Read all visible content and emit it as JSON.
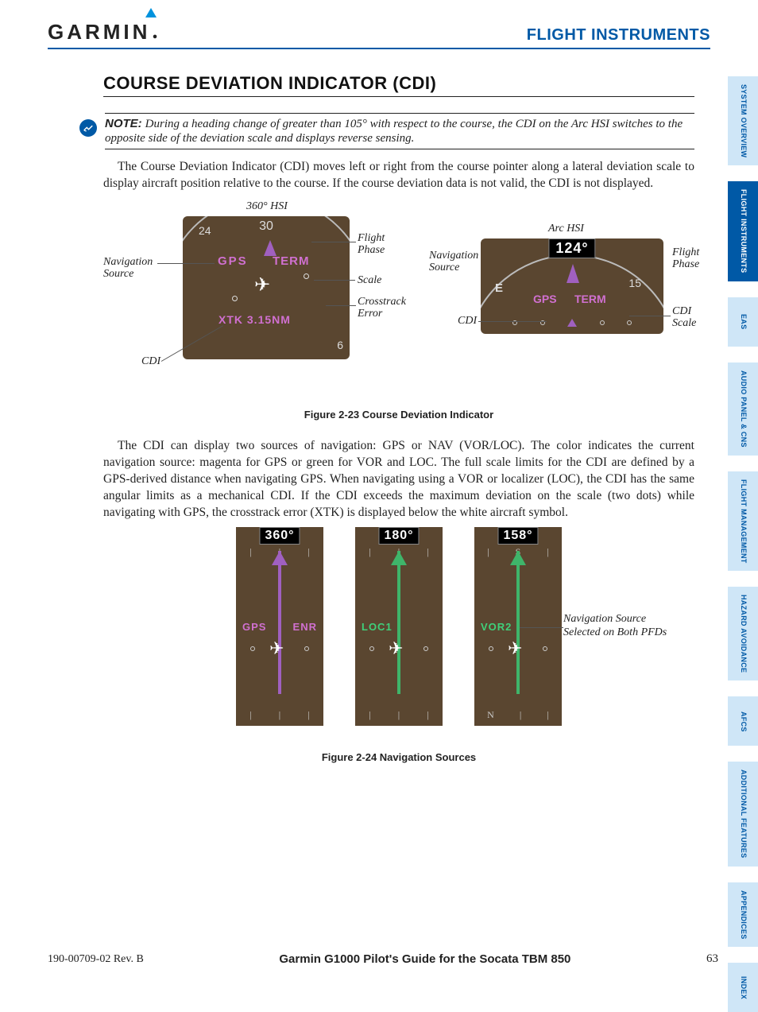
{
  "header": {
    "brand": "GARMIN",
    "section": "FLIGHT INSTRUMENTS"
  },
  "heading": "COURSE DEVIATION INDICATOR (CDI)",
  "note": {
    "label": "NOTE:",
    "text": "During a heading change of greater than 105° with respect to the course, the CDI on the Arc HSI switches to the opposite side of the deviation scale and displays reverse sensing."
  },
  "paragraphs": {
    "p1": "The Course Deviation Indicator (CDI) moves left or right from the course pointer along a lateral deviation scale to display aircraft position relative to the course.  If the course deviation data is not valid, the CDI is not displayed.",
    "p2": "The CDI can display two sources of navigation: GPS or NAV (VOR/LOC).  The color indicates the current navigation source: magenta for GPS or green for VOR and LOC.  The full scale limits for the CDI are defined by a GPS-derived distance when navigating GPS.  When navigating using a VOR or localizer (LOC), the CDI has the same angular limits as a mechanical CDI.  If the CDI exceeds the maximum deviation on the scale (two dots) while navigating with GPS, the crosstrack error (XTK) is displayed below the white aircraft symbol."
  },
  "fig23": {
    "caption": "Figure 2-23  Course Deviation Indicator",
    "left_title": "360° HSI",
    "right_title": "Arc HSI",
    "hsi360": {
      "gps": "GPS",
      "term": "TERM",
      "xtk": "XTK 3.15NM",
      "tick_top": "30",
      "tick_left": "24",
      "tick_right": "6"
    },
    "arc": {
      "heading": "124°",
      "gps": "GPS",
      "term": "TERM",
      "tick_e": "E",
      "tick_15": "15"
    },
    "callouts": {
      "nav_src": "Navigation\nSource",
      "flight_phase": "Flight\nPhase",
      "scale": "Scale",
      "xtk_err": "Crosstrack\nError",
      "cdi": "CDI",
      "cdi_scale": "CDI\nScale"
    }
  },
  "fig24": {
    "caption": "Figure 2-24  Navigation Sources",
    "strips": [
      {
        "heading": "360°",
        "src_left": "GPS",
        "src_right": "ENR"
      },
      {
        "heading": "180°",
        "src_left": "LOC1",
        "src_right": ""
      },
      {
        "heading": "158°",
        "src_left": "VOR2",
        "src_right": ""
      }
    ],
    "callout": "Navigation Source Selected on Both PFDs"
  },
  "tabs": [
    {
      "label": "SYSTEM OVERVIEW",
      "active": false
    },
    {
      "label": "FLIGHT INSTRUMENTS",
      "active": true
    },
    {
      "label": "EAS",
      "active": false
    },
    {
      "label": "AUDIO PANEL & CNS",
      "active": false
    },
    {
      "label": "FLIGHT MANAGEMENT",
      "active": false
    },
    {
      "label": "HAZARD AVOIDANCE",
      "active": false
    },
    {
      "label": "AFCS",
      "active": false
    },
    {
      "label": "ADDITIONAL FEATURES",
      "active": false
    },
    {
      "label": "APPENDICES",
      "active": false
    },
    {
      "label": "INDEX",
      "active": false
    }
  ],
  "footer": {
    "docid": "190-00709-02  Rev. B",
    "title": "Garmin G1000 Pilot's Guide for the Socata TBM 850",
    "page": "63"
  }
}
